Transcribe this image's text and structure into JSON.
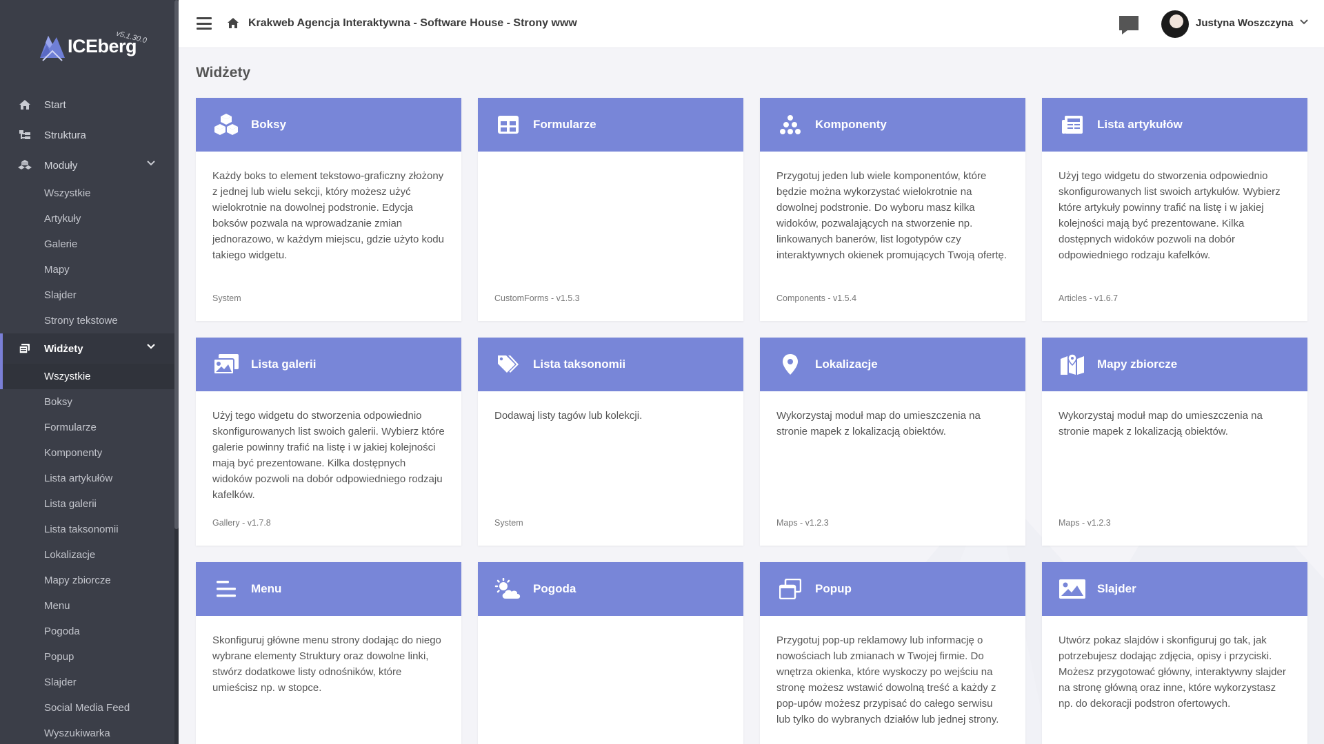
{
  "logo": {
    "brand": "ICEberg",
    "version": "v5.1.30.0"
  },
  "sidebar": {
    "items": [
      {
        "label": "Start",
        "icon": "home-icon"
      },
      {
        "label": "Struktura",
        "icon": "structure-icon"
      },
      {
        "label": "Moduły",
        "icon": "modules-icon"
      }
    ],
    "modules_sub": [
      "Wszystkie",
      "Artykuły",
      "Galerie",
      "Mapy",
      "Slajder",
      "Strony tekstowe"
    ],
    "widgets_label": "Widżety",
    "widgets_sub": [
      "Wszystkie",
      "Boksy",
      "Formularze",
      "Komponenty",
      "Lista artykułów",
      "Lista galerii",
      "Lista taksonomii",
      "Lokalizacje",
      "Mapy zbiorcze",
      "Menu",
      "Pogoda",
      "Popup",
      "Slajder",
      "Social Media Feed",
      "Wyszukiwarka"
    ]
  },
  "header": {
    "site_title": "Krakweb Agencja Interaktywna - Software House - Strony www",
    "user_name": "Justyna Woszczyna"
  },
  "main": {
    "page_title": "Widżety",
    "cards": [
      {
        "title": "Boksy",
        "icon": "cubes-icon",
        "desc": "Każdy boks to element tekstowo-graficzny złożony z jednej lub wielu sekcji, który możesz użyć wielokrotnie na dowolnej podstronie. Edycja boksów pozwala na wprowadzanie zmian jednorazowo, w każdym miejscu, gdzie użyto kodu takiego widgetu.",
        "meta": "System"
      },
      {
        "title": "Formularze",
        "icon": "form-table-icon",
        "desc": "",
        "meta": "CustomForms - v1.5.3"
      },
      {
        "title": "Komponenty",
        "icon": "components-icon",
        "desc": "Przygotuj jeden lub wiele komponentów, które będzie można wykorzystać wielokrotnie na dowolnej podstronie. Do wyboru masz kilka widoków, pozwalających na stworzenie np. linkowanych banerów, list logotypów czy interaktywnych okienek promujących Twoją ofertę.",
        "meta": "Components - v1.5.4"
      },
      {
        "title": "Lista artykułów",
        "icon": "newspaper-icon",
        "desc": "Użyj tego widgetu do stworzenia odpowiednio skonfigurowanych list swoich artykułów. Wybierz które artykuły powinny trafić na listę i w jakiej kolejności mają być prezentowane. Kilka dostępnych widoków pozwoli na dobór odpowiedniego rodzaju kafelków.",
        "meta": "Articles - v1.6.7"
      },
      {
        "title": "Lista galerii",
        "icon": "images-icon",
        "desc": "Użyj tego widgetu do stworzenia odpowiednio skonfigurowanych list swoich galerii. Wybierz które galerie powinny trafić na listę i w jakiej kolejności mają być prezentowane. Kilka dostępnych widoków pozwoli na dobór odpowiedniego rodzaju kafelków.",
        "meta": "Gallery - v1.7.8"
      },
      {
        "title": "Lista taksonomii",
        "icon": "tags-icon",
        "desc": "Dodawaj listy tagów lub kolekcji.",
        "meta": "System"
      },
      {
        "title": "Lokalizacje",
        "icon": "map-marker-icon",
        "desc": "Wykorzystaj moduł map do umieszczenia na stronie mapek z lokalizacją obiektów.",
        "meta": "Maps - v1.2.3"
      },
      {
        "title": "Mapy zbiorcze",
        "icon": "map-icon",
        "desc": "Wykorzystaj moduł map do umieszczenia na stronie mapek z lokalizacją obiektów.",
        "meta": "Maps - v1.2.3"
      },
      {
        "title": "Menu",
        "icon": "menu-lines-icon",
        "desc": "Skonfiguruj główne menu strony dodając do niego wybrane elementy Struktury oraz dowolne linki, stwórz dodatkowe listy odnośników, które umieścisz np. w stopce.",
        "meta": ""
      },
      {
        "title": "Pogoda",
        "icon": "weather-icon",
        "desc": "",
        "meta": ""
      },
      {
        "title": "Popup",
        "icon": "window-restore-icon",
        "desc": "Przygotuj pop-up reklamowy lub informację o nowościach lub zmianach w Twojej firmie. Do wnętrza okienka, które wyskoczy po wejściu na stronę możesz wstawić dowolną treść a każdy z pop-upów możesz przypisać do całego serwisu lub tylko do wybranych działów lub jednej strony.",
        "meta": ""
      },
      {
        "title": "Slajder",
        "icon": "image-icon",
        "desc": "Utwórz pokaz slajdów i skonfiguruj go tak, jak potrzebujesz dodając zdjęcia, opisy i przyciski. Możesz przygotować główny, interaktywny slajder na stronę główną oraz inne, które wykorzystasz np. do dekoracji podstron ofertowych.",
        "meta": ""
      }
    ]
  },
  "colors": {
    "sidebar_bg": "#3b3e48",
    "card_header": "#7886d8",
    "accent": "#7a7fd6",
    "page_bg": "#f4f4f8"
  }
}
